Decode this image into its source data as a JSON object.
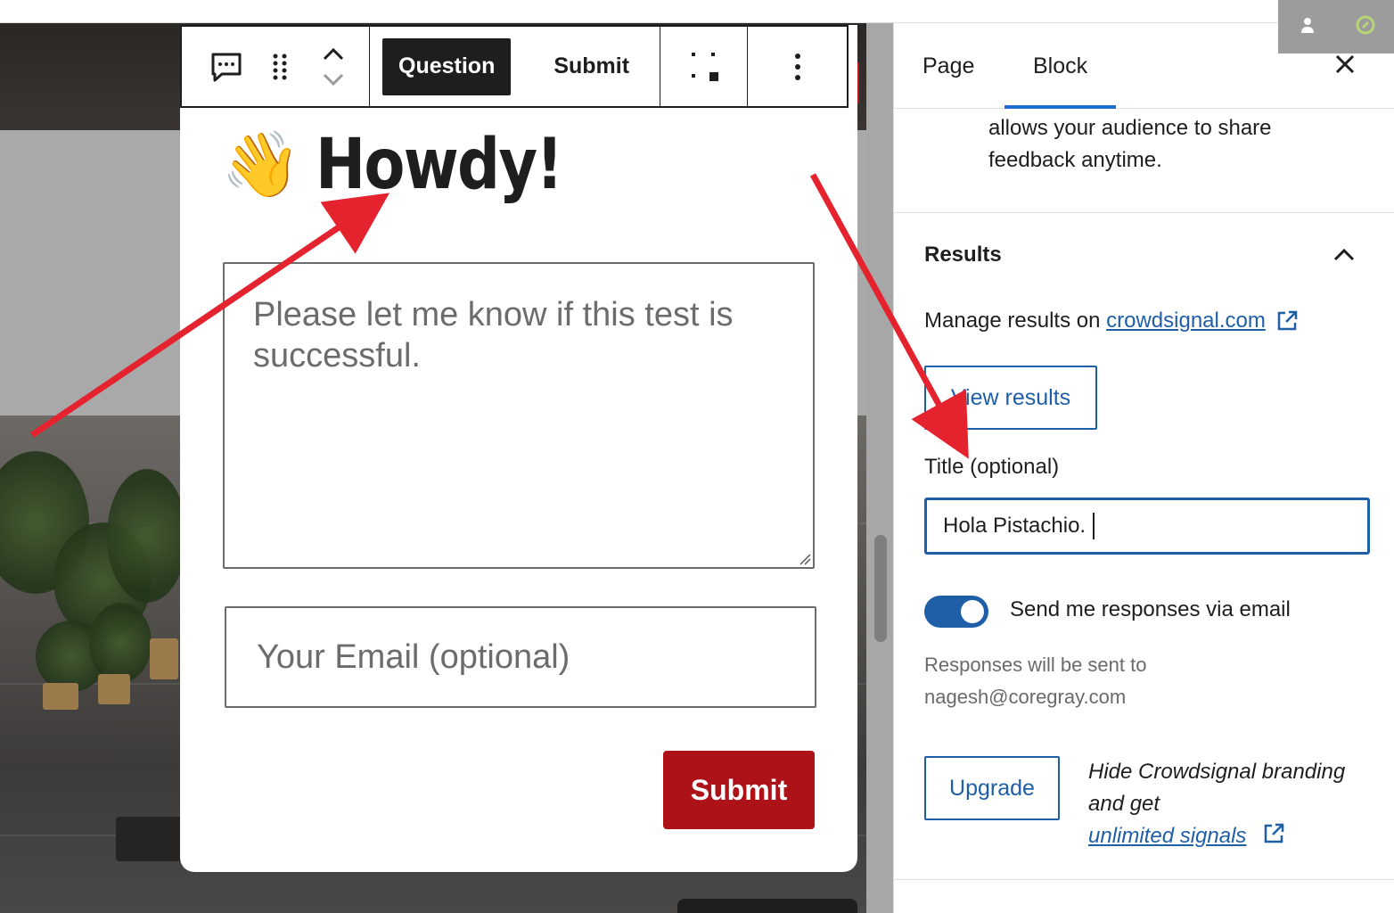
{
  "toolbar": {
    "question_label": "Question",
    "submit_label": "Submit"
  },
  "block": {
    "emoji": "👋",
    "title": "Howdy!",
    "question_placeholder": "Please let me know if this test is successful.",
    "email_placeholder": "Your Email (optional)",
    "submit_label": "Submit"
  },
  "sidebar": {
    "tabs": [
      {
        "label": "Page"
      },
      {
        "label": "Block"
      }
    ],
    "description": "allows your audience to share feedback anytime.",
    "results": {
      "title": "Results",
      "manage_prefix": "Manage results on",
      "manage_link": "crowdsignal.com",
      "view_results_label": "View results",
      "title_field_label": "Title (optional)",
      "title_field_value": "Hola Pistachio.",
      "toggle_label": "Send me responses via email",
      "toggle_on": true,
      "responses_note": "Responses will be sent to nagesh@coregray.com",
      "upgrade_label": "Upgrade",
      "upsell_text": "Hide Crowdsignal branding and get",
      "upsell_link": "unlimited signals"
    }
  },
  "colors": {
    "accent": "#1f5fa8",
    "submit_red": "#ad1218",
    "annotation_red": "#e4232f",
    "toolbar_dark": "#1e1e1e"
  },
  "icons": {
    "toolbar": [
      "feedback-icon",
      "drag-handle-icon",
      "move-up-down-icon",
      "align-icon",
      "more-options-icon"
    ],
    "sidebar": [
      "close-icon",
      "chevron-up-icon",
      "external-link-icon"
    ]
  }
}
